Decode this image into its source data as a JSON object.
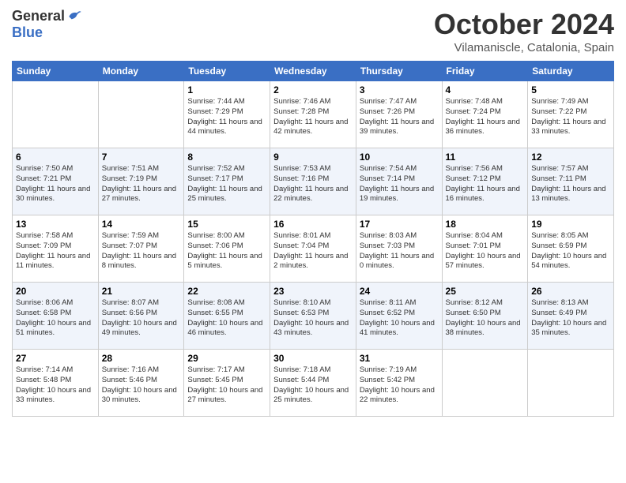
{
  "header": {
    "logo_general": "General",
    "logo_blue": "Blue",
    "month": "October 2024",
    "location": "Vilamaniscle, Catalonia, Spain"
  },
  "days_of_week": [
    "Sunday",
    "Monday",
    "Tuesday",
    "Wednesday",
    "Thursday",
    "Friday",
    "Saturday"
  ],
  "weeks": [
    [
      {
        "num": "",
        "sunrise": "",
        "sunset": "",
        "daylight": ""
      },
      {
        "num": "",
        "sunrise": "",
        "sunset": "",
        "daylight": ""
      },
      {
        "num": "1",
        "sunrise": "Sunrise: 7:44 AM",
        "sunset": "Sunset: 7:29 PM",
        "daylight": "Daylight: 11 hours and 44 minutes."
      },
      {
        "num": "2",
        "sunrise": "Sunrise: 7:46 AM",
        "sunset": "Sunset: 7:28 PM",
        "daylight": "Daylight: 11 hours and 42 minutes."
      },
      {
        "num": "3",
        "sunrise": "Sunrise: 7:47 AM",
        "sunset": "Sunset: 7:26 PM",
        "daylight": "Daylight: 11 hours and 39 minutes."
      },
      {
        "num": "4",
        "sunrise": "Sunrise: 7:48 AM",
        "sunset": "Sunset: 7:24 PM",
        "daylight": "Daylight: 11 hours and 36 minutes."
      },
      {
        "num": "5",
        "sunrise": "Sunrise: 7:49 AM",
        "sunset": "Sunset: 7:22 PM",
        "daylight": "Daylight: 11 hours and 33 minutes."
      }
    ],
    [
      {
        "num": "6",
        "sunrise": "Sunrise: 7:50 AM",
        "sunset": "Sunset: 7:21 PM",
        "daylight": "Daylight: 11 hours and 30 minutes."
      },
      {
        "num": "7",
        "sunrise": "Sunrise: 7:51 AM",
        "sunset": "Sunset: 7:19 PM",
        "daylight": "Daylight: 11 hours and 27 minutes."
      },
      {
        "num": "8",
        "sunrise": "Sunrise: 7:52 AM",
        "sunset": "Sunset: 7:17 PM",
        "daylight": "Daylight: 11 hours and 25 minutes."
      },
      {
        "num": "9",
        "sunrise": "Sunrise: 7:53 AM",
        "sunset": "Sunset: 7:16 PM",
        "daylight": "Daylight: 11 hours and 22 minutes."
      },
      {
        "num": "10",
        "sunrise": "Sunrise: 7:54 AM",
        "sunset": "Sunset: 7:14 PM",
        "daylight": "Daylight: 11 hours and 19 minutes."
      },
      {
        "num": "11",
        "sunrise": "Sunrise: 7:56 AM",
        "sunset": "Sunset: 7:12 PM",
        "daylight": "Daylight: 11 hours and 16 minutes."
      },
      {
        "num": "12",
        "sunrise": "Sunrise: 7:57 AM",
        "sunset": "Sunset: 7:11 PM",
        "daylight": "Daylight: 11 hours and 13 minutes."
      }
    ],
    [
      {
        "num": "13",
        "sunrise": "Sunrise: 7:58 AM",
        "sunset": "Sunset: 7:09 PM",
        "daylight": "Daylight: 11 hours and 11 minutes."
      },
      {
        "num": "14",
        "sunrise": "Sunrise: 7:59 AM",
        "sunset": "Sunset: 7:07 PM",
        "daylight": "Daylight: 11 hours and 8 minutes."
      },
      {
        "num": "15",
        "sunrise": "Sunrise: 8:00 AM",
        "sunset": "Sunset: 7:06 PM",
        "daylight": "Daylight: 11 hours and 5 minutes."
      },
      {
        "num": "16",
        "sunrise": "Sunrise: 8:01 AM",
        "sunset": "Sunset: 7:04 PM",
        "daylight": "Daylight: 11 hours and 2 minutes."
      },
      {
        "num": "17",
        "sunrise": "Sunrise: 8:03 AM",
        "sunset": "Sunset: 7:03 PM",
        "daylight": "Daylight: 11 hours and 0 minutes."
      },
      {
        "num": "18",
        "sunrise": "Sunrise: 8:04 AM",
        "sunset": "Sunset: 7:01 PM",
        "daylight": "Daylight: 10 hours and 57 minutes."
      },
      {
        "num": "19",
        "sunrise": "Sunrise: 8:05 AM",
        "sunset": "Sunset: 6:59 PM",
        "daylight": "Daylight: 10 hours and 54 minutes."
      }
    ],
    [
      {
        "num": "20",
        "sunrise": "Sunrise: 8:06 AM",
        "sunset": "Sunset: 6:58 PM",
        "daylight": "Daylight: 10 hours and 51 minutes."
      },
      {
        "num": "21",
        "sunrise": "Sunrise: 8:07 AM",
        "sunset": "Sunset: 6:56 PM",
        "daylight": "Daylight: 10 hours and 49 minutes."
      },
      {
        "num": "22",
        "sunrise": "Sunrise: 8:08 AM",
        "sunset": "Sunset: 6:55 PM",
        "daylight": "Daylight: 10 hours and 46 minutes."
      },
      {
        "num": "23",
        "sunrise": "Sunrise: 8:10 AM",
        "sunset": "Sunset: 6:53 PM",
        "daylight": "Daylight: 10 hours and 43 minutes."
      },
      {
        "num": "24",
        "sunrise": "Sunrise: 8:11 AM",
        "sunset": "Sunset: 6:52 PM",
        "daylight": "Daylight: 10 hours and 41 minutes."
      },
      {
        "num": "25",
        "sunrise": "Sunrise: 8:12 AM",
        "sunset": "Sunset: 6:50 PM",
        "daylight": "Daylight: 10 hours and 38 minutes."
      },
      {
        "num": "26",
        "sunrise": "Sunrise: 8:13 AM",
        "sunset": "Sunset: 6:49 PM",
        "daylight": "Daylight: 10 hours and 35 minutes."
      }
    ],
    [
      {
        "num": "27",
        "sunrise": "Sunrise: 7:14 AM",
        "sunset": "Sunset: 5:48 PM",
        "daylight": "Daylight: 10 hours and 33 minutes."
      },
      {
        "num": "28",
        "sunrise": "Sunrise: 7:16 AM",
        "sunset": "Sunset: 5:46 PM",
        "daylight": "Daylight: 10 hours and 30 minutes."
      },
      {
        "num": "29",
        "sunrise": "Sunrise: 7:17 AM",
        "sunset": "Sunset: 5:45 PM",
        "daylight": "Daylight: 10 hours and 27 minutes."
      },
      {
        "num": "30",
        "sunrise": "Sunrise: 7:18 AM",
        "sunset": "Sunset: 5:44 PM",
        "daylight": "Daylight: 10 hours and 25 minutes."
      },
      {
        "num": "31",
        "sunrise": "Sunrise: 7:19 AM",
        "sunset": "Sunset: 5:42 PM",
        "daylight": "Daylight: 10 hours and 22 minutes."
      },
      {
        "num": "",
        "sunrise": "",
        "sunset": "",
        "daylight": ""
      },
      {
        "num": "",
        "sunrise": "",
        "sunset": "",
        "daylight": ""
      }
    ]
  ]
}
